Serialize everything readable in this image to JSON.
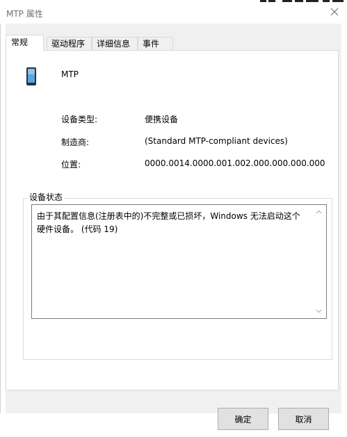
{
  "window": {
    "title": "MTP 属性"
  },
  "tabs": [
    {
      "label": "常规",
      "active": true
    },
    {
      "label": "驱动程序",
      "active": false
    },
    {
      "label": "详细信息",
      "active": false
    },
    {
      "label": "事件",
      "active": false
    }
  ],
  "device": {
    "name": "MTP",
    "icon": "portable-device-icon"
  },
  "properties": [
    {
      "label": "设备类型:",
      "value": "便携设备"
    },
    {
      "label": "制造商:",
      "value": "(Standard MTP-compliant devices)"
    },
    {
      "label": "位置:",
      "value": "0000.0014.0000.001.002.000.000.000.000"
    }
  ],
  "status": {
    "group_title": "设备状态",
    "message": "由于其配置信息(注册表中的)不完整或已损坏，Windows 无法启动这个硬件设备。 (代码 19)"
  },
  "buttons": {
    "ok": "确定",
    "cancel": "取消"
  },
  "colors": {
    "background": "#f0f0f0",
    "panel": "#ffffff",
    "button": "#e1e1e1"
  }
}
